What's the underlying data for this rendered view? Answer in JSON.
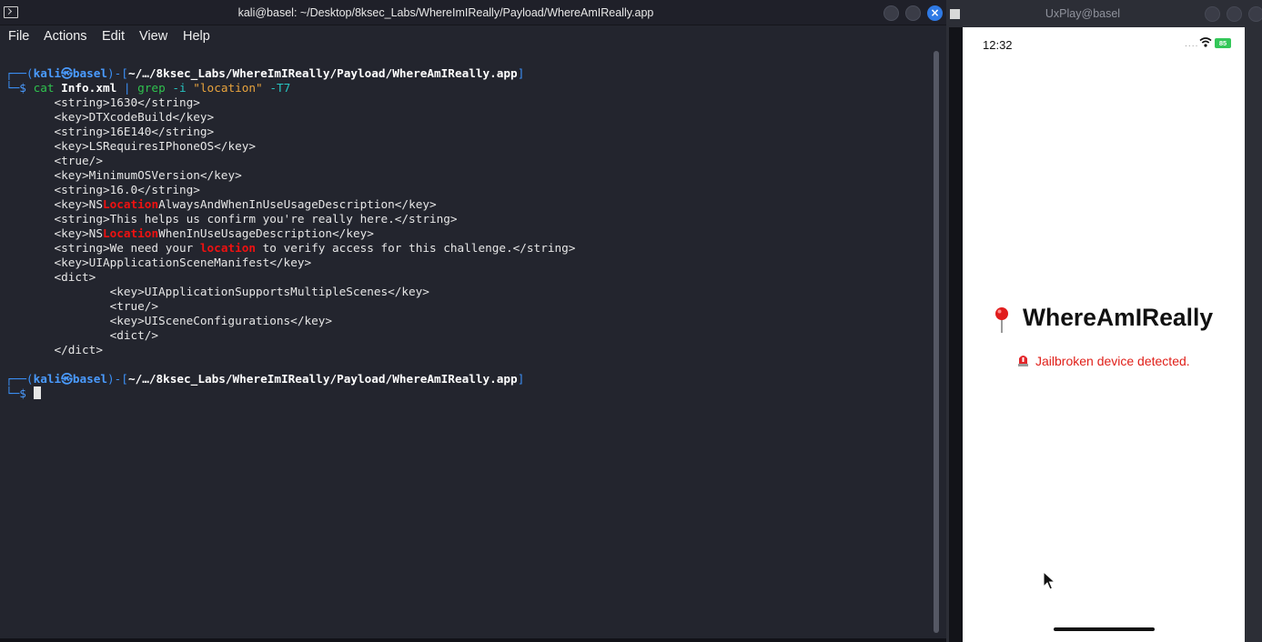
{
  "terminal": {
    "title": "kali@basel: ~/Desktop/8ksec_Labs/WhereImIReally/Payload/WhereAmIReally.app",
    "menu": [
      "File",
      "Actions",
      "Edit",
      "View",
      "Help"
    ],
    "prompt": {
      "user": "kali",
      "at_symbol": "㉿",
      "host": "basel",
      "path": "~/…/8ksec_Labs/WhereImIReally/Payload/WhereAmIReally.app"
    },
    "command": {
      "cmd": "cat",
      "file": "Info.xml",
      "pipe": "|",
      "grep": "grep",
      "flag": "-i",
      "pattern": "\"location\"",
      "context_flag": "-T7"
    },
    "output": [
      {
        "indent": "       ",
        "pre": "<string>1630</string>",
        "hl": "",
        "post": ""
      },
      {
        "indent": "       ",
        "pre": "<key>DTXcodeBuild</key>",
        "hl": "",
        "post": ""
      },
      {
        "indent": "       ",
        "pre": "<string>16E140</string>",
        "hl": "",
        "post": ""
      },
      {
        "indent": "       ",
        "pre": "<key>LSRequiresIPhoneOS</key>",
        "hl": "",
        "post": ""
      },
      {
        "indent": "       ",
        "pre": "<true/>",
        "hl": "",
        "post": ""
      },
      {
        "indent": "       ",
        "pre": "<key>MinimumOSVersion</key>",
        "hl": "",
        "post": ""
      },
      {
        "indent": "       ",
        "pre": "<string>16.0</string>",
        "hl": "",
        "post": ""
      },
      {
        "indent": "       ",
        "pre": "<key>NS",
        "hl": "Location",
        "post": "AlwaysAndWhenInUseUsageDescription</key>"
      },
      {
        "indent": "       ",
        "pre": "<string>This helps us confirm you're really here.</string>",
        "hl": "",
        "post": ""
      },
      {
        "indent": "       ",
        "pre": "<key>NS",
        "hl": "Location",
        "post": "WhenInUseUsageDescription</key>"
      },
      {
        "indent": "       ",
        "pre": "<string>We need your ",
        "hl": "location",
        "post": " to verify access for this challenge.</string>"
      },
      {
        "indent": "       ",
        "pre": "<key>UIApplicationSceneManifest</key>",
        "hl": "",
        "post": ""
      },
      {
        "indent": "       ",
        "pre": "<dict>",
        "hl": "",
        "post": ""
      },
      {
        "indent": "               ",
        "pre": "<key>UIApplicationSupportsMultipleScenes</key>",
        "hl": "",
        "post": ""
      },
      {
        "indent": "               ",
        "pre": "<true/>",
        "hl": "",
        "post": ""
      },
      {
        "indent": "               ",
        "pre": "<key>UISceneConfigurations</key>",
        "hl": "",
        "post": ""
      },
      {
        "indent": "               ",
        "pre": "<dict/>",
        "hl": "",
        "post": ""
      },
      {
        "indent": "       ",
        "pre": "</dict>",
        "hl": "",
        "post": ""
      }
    ]
  },
  "uxplay": {
    "title": "UxPlay@basel",
    "phone": {
      "time": "12:32",
      "signal": "....",
      "battery": "85",
      "app_title": "WhereAmIReally",
      "status_message": "Jailbroken device detected.",
      "icons": [
        "pin-icon",
        "siren-icon"
      ]
    }
  },
  "colors": {
    "accent_blue": "#3b8ff5",
    "highlight_red": "#ee1111",
    "status_red": "#e0201a",
    "battery_green": "#34c759"
  }
}
